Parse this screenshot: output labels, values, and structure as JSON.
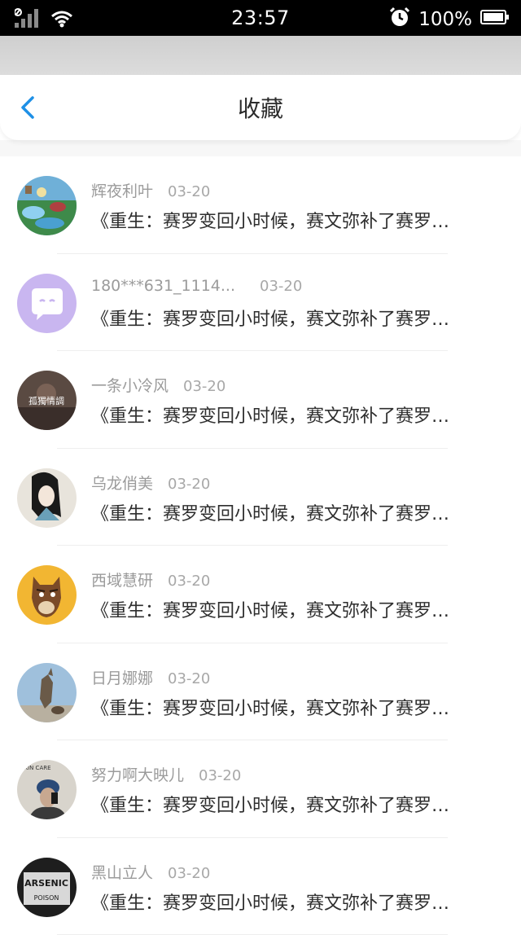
{
  "status_bar": {
    "time": "23:57",
    "battery": "100%",
    "icons": [
      "no-sim-icon",
      "signal-icon",
      "wifi-icon",
      "alarm-icon",
      "battery-icon"
    ]
  },
  "header": {
    "title": "收藏",
    "back_icon": "chevron-left-icon"
  },
  "colors": {
    "accent": "#1e90e6",
    "background": "#f7f7f7",
    "username": "#9b9b9b",
    "text": "#2e2e2e"
  },
  "items": [
    {
      "username": "辉夜利叶",
      "date": "03-20",
      "content": "《重生：赛罗变回小时候，赛文弥补了赛罗…"
    },
    {
      "username": "180***631_1114...",
      "date": "03-20",
      "content": "《重生：赛罗变回小时候，赛文弥补了赛罗…"
    },
    {
      "username": "一条小冷风",
      "date": "03-20",
      "content": "《重生：赛罗变回小时候，赛文弥补了赛罗…"
    },
    {
      "username": "乌龙俏美",
      "date": "03-20",
      "content": "《重生：赛罗变回小时候，赛文弥补了赛罗…"
    },
    {
      "username": "西域慧研",
      "date": "03-20",
      "content": "《重生：赛罗变回小时候，赛文弥补了赛罗…"
    },
    {
      "username": "日月娜娜",
      "date": "03-20",
      "content": "《重生：赛罗变回小时候，赛文弥补了赛罗…"
    },
    {
      "username": "努力啊大映儿",
      "date": "03-20",
      "content": "《重生：赛罗变回小时候，赛文弥补了赛罗…"
    },
    {
      "username": "黑山立人",
      "date": "03-20",
      "content": "《重生：赛罗变回小时候，赛文弥补了赛罗…"
    }
  ],
  "avatar_text": {
    "item3": "孤獨情調",
    "item7": "SKIN CARE",
    "item8_line1": "ARSENIC",
    "item8_line2": "POISON"
  }
}
